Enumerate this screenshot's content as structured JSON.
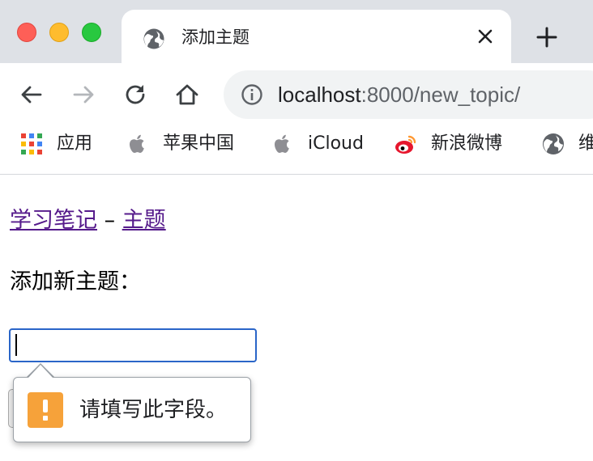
{
  "browser": {
    "tab": {
      "title": "添加主题",
      "icon": "globe-icon"
    },
    "toolbar": {
      "url_host": "localhost",
      "url_path": ":8000/new_topic/"
    },
    "bookmarks": [
      {
        "label": "应用",
        "icon": "apps-grid-icon"
      },
      {
        "label": "苹果中国",
        "icon": "apple-icon"
      },
      {
        "label": "iCloud",
        "icon": "apple-icon"
      },
      {
        "label": "新浪微博",
        "icon": "weibo-icon"
      },
      {
        "label": "维",
        "icon": "globe-icon"
      }
    ]
  },
  "page": {
    "header": {
      "home_link": "学习笔记",
      "separator": "–",
      "topics_link": "主题"
    },
    "form": {
      "label": "添加新主题：",
      "input_value": ""
    },
    "validation": {
      "message": "请填写此字段。",
      "icon": "warning-icon"
    }
  },
  "colors": {
    "tab_strip": "#dee1e6",
    "link_visited": "#551a8b",
    "focus_ring": "#2a65c8",
    "warning": "#f6a23a"
  }
}
